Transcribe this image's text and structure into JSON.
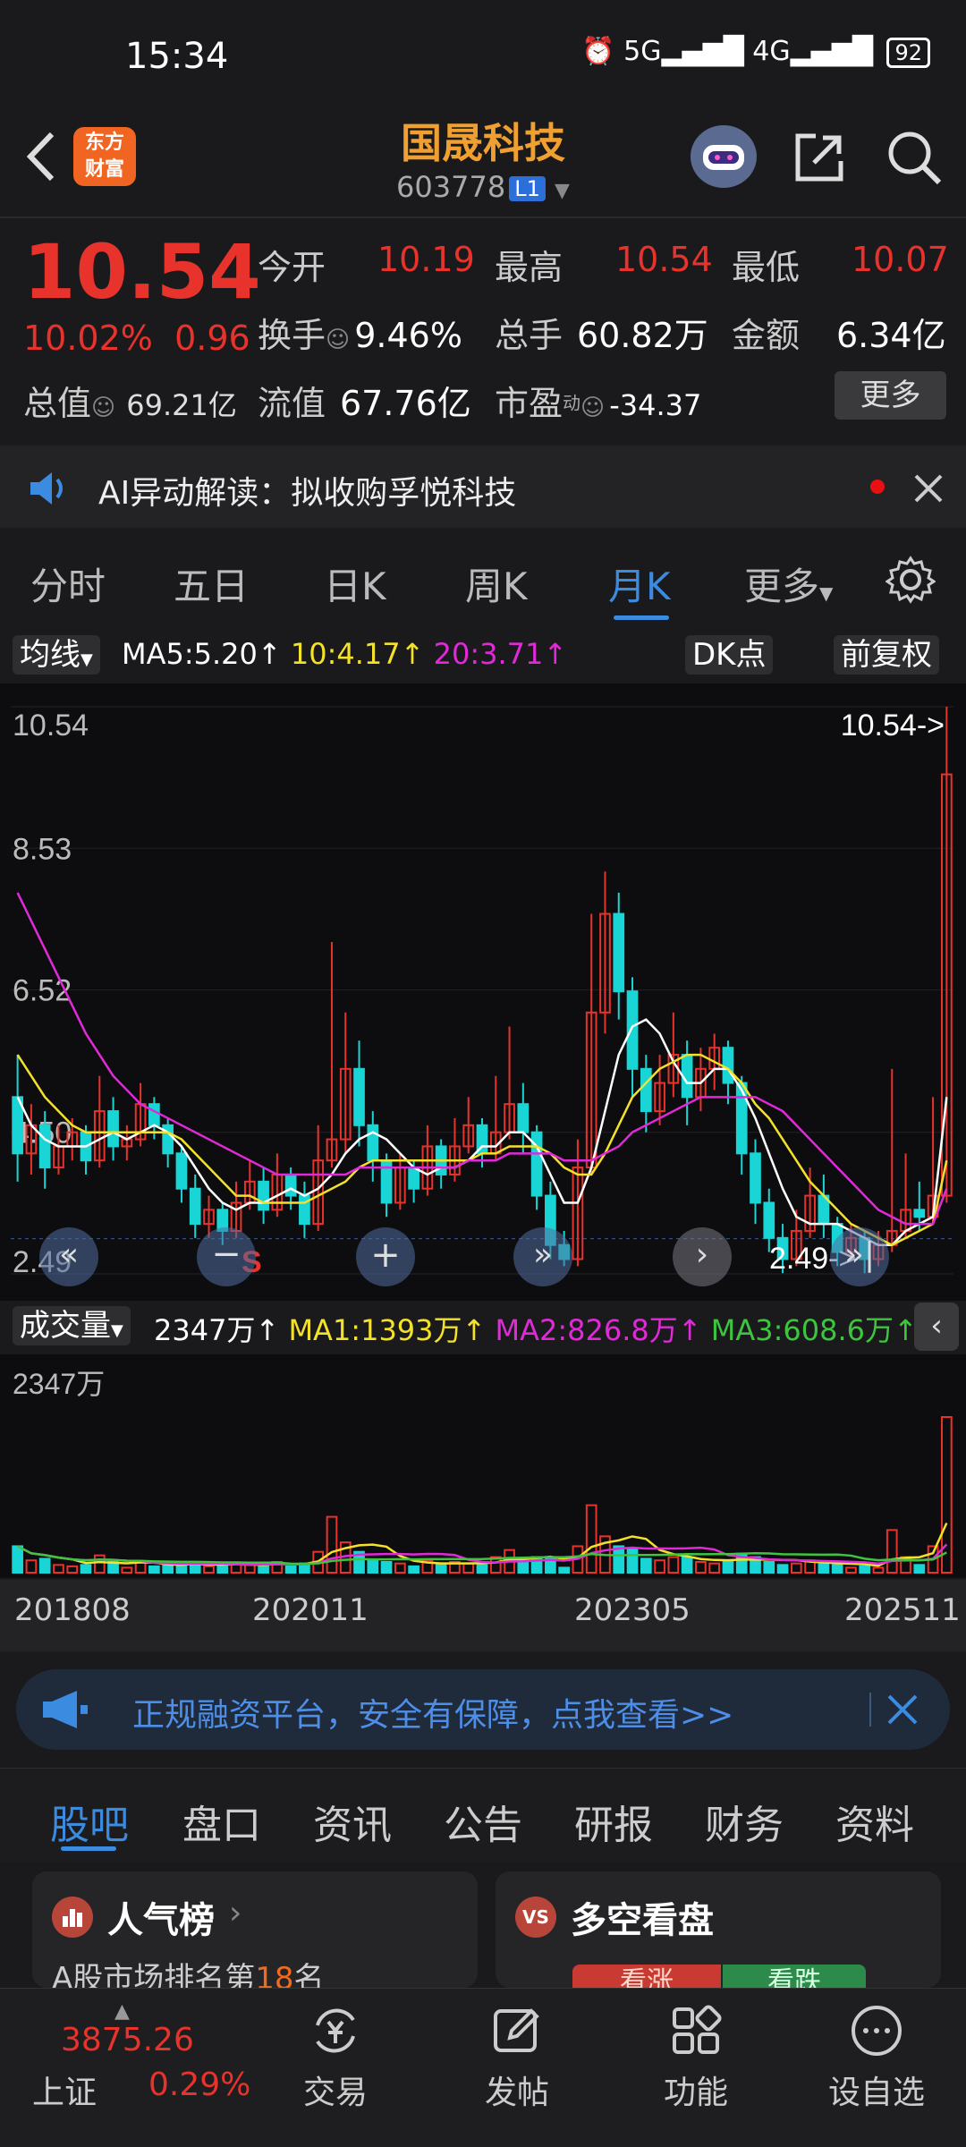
{
  "status_bar": {
    "time": "15:34",
    "icons": "⏰ 5G▂▄▆█ 4G▂▄▆█",
    "battery": "92"
  },
  "header": {
    "logo_text_1": "东方",
    "logo_text_2": "财富",
    "stock_name": "国晟科技",
    "stock_code": "603778",
    "level_badge": "L1"
  },
  "quote": {
    "price": "10.54",
    "change_pct": "10.02%",
    "change_abs": "0.96",
    "total_value_label": "总值",
    "total_value": "69.21亿",
    "open_label": "今开",
    "open": "10.19",
    "high_label": "最高",
    "high": "10.54",
    "low_label": "最低",
    "low": "10.07",
    "turnover_label": "换手",
    "turnover": "9.46%",
    "volume_label": "总手",
    "volume": "60.82万",
    "amount_label": "金额",
    "amount": "6.34亿",
    "float_label": "流值",
    "float_value": "67.76亿",
    "pe_label": "市盈",
    "pe_sup": "动",
    "pe": "-34.37",
    "more_button": "更多"
  },
  "ai_banner": {
    "text": "AI异动解读：拟收购孚悦科技"
  },
  "period_tabs": [
    "分时",
    "五日",
    "日K",
    "周K",
    "月K",
    "更多"
  ],
  "active_tab": "月K",
  "chart_toolbar": {
    "indicator": "均线",
    "ma5": "MA5:5.20↑",
    "ma10": "10:4.17↑",
    "ma20": "20:3.71↑",
    "dk": "DK点",
    "adjust": "前复权"
  },
  "chart_data": {
    "type": "candlestick",
    "y_ticks": [
      "10.54",
      "8.53",
      "6.52",
      "4.50",
      "2.49"
    ],
    "ylim": [
      2.49,
      10.54
    ],
    "max_marker": "10.54->",
    "min_marker": "2.49->",
    "signal_label": "S",
    "x_ticks": [
      "201808",
      "202011",
      "202305",
      "202511"
    ],
    "candles": [
      {
        "o": 5.0,
        "c": 4.2,
        "h": 5.6,
        "l": 3.8
      },
      {
        "o": 4.2,
        "c": 4.6,
        "h": 4.9,
        "l": 3.9
      },
      {
        "o": 4.6,
        "c": 4.0,
        "h": 4.8,
        "l": 3.7
      },
      {
        "o": 4.0,
        "c": 4.3,
        "h": 4.6,
        "l": 3.9
      },
      {
        "o": 4.3,
        "c": 4.5,
        "h": 4.7,
        "l": 4.1
      },
      {
        "o": 4.5,
        "c": 4.1,
        "h": 4.6,
        "l": 3.9
      },
      {
        "o": 4.1,
        "c": 4.8,
        "h": 5.3,
        "l": 4.0
      },
      {
        "o": 4.8,
        "c": 4.3,
        "h": 5.0,
        "l": 4.1
      },
      {
        "o": 4.3,
        "c": 4.4,
        "h": 4.6,
        "l": 4.1
      },
      {
        "o": 4.4,
        "c": 4.9,
        "h": 5.2,
        "l": 4.3
      },
      {
        "o": 4.9,
        "c": 4.6,
        "h": 5.0,
        "l": 4.4
      },
      {
        "o": 4.6,
        "c": 4.2,
        "h": 4.7,
        "l": 4.0
      },
      {
        "o": 4.2,
        "c": 3.7,
        "h": 4.3,
        "l": 3.5
      },
      {
        "o": 3.7,
        "c": 3.2,
        "h": 3.9,
        "l": 3.0
      },
      {
        "o": 3.2,
        "c": 3.4,
        "h": 3.6,
        "l": 3.0
      },
      {
        "o": 3.4,
        "c": 3.1,
        "h": 3.5,
        "l": 2.9
      },
      {
        "o": 3.1,
        "c": 3.5,
        "h": 3.8,
        "l": 3.0
      },
      {
        "o": 3.5,
        "c": 3.8,
        "h": 4.1,
        "l": 3.4
      },
      {
        "o": 3.8,
        "c": 3.4,
        "h": 4.0,
        "l": 3.2
      },
      {
        "o": 3.4,
        "c": 3.9,
        "h": 4.2,
        "l": 3.3
      },
      {
        "o": 3.9,
        "c": 3.6,
        "h": 4.0,
        "l": 3.4
      },
      {
        "o": 3.6,
        "c": 3.2,
        "h": 3.8,
        "l": 3.0
      },
      {
        "o": 3.2,
        "c": 4.1,
        "h": 4.6,
        "l": 3.1
      },
      {
        "o": 4.1,
        "c": 4.4,
        "h": 7.2,
        "l": 4.0
      },
      {
        "o": 4.4,
        "c": 5.4,
        "h": 6.2,
        "l": 4.2
      },
      {
        "o": 5.4,
        "c": 4.6,
        "h": 5.8,
        "l": 4.3
      },
      {
        "o": 4.6,
        "c": 4.1,
        "h": 4.8,
        "l": 3.8
      },
      {
        "o": 4.1,
        "c": 3.5,
        "h": 4.2,
        "l": 3.3
      },
      {
        "o": 3.5,
        "c": 4.0,
        "h": 4.2,
        "l": 3.4
      },
      {
        "o": 4.0,
        "c": 3.7,
        "h": 4.1,
        "l": 3.5
      },
      {
        "o": 3.7,
        "c": 4.3,
        "h": 4.6,
        "l": 3.6
      },
      {
        "o": 4.3,
        "c": 3.9,
        "h": 4.4,
        "l": 3.7
      },
      {
        "o": 3.9,
        "c": 4.3,
        "h": 4.7,
        "l": 3.8
      },
      {
        "o": 4.3,
        "c": 4.6,
        "h": 5.0,
        "l": 4.2
      },
      {
        "o": 4.6,
        "c": 4.2,
        "h": 4.7,
        "l": 4.0
      },
      {
        "o": 4.2,
        "c": 4.5,
        "h": 5.3,
        "l": 4.1
      },
      {
        "o": 4.5,
        "c": 4.9,
        "h": 6.0,
        "l": 4.4
      },
      {
        "o": 4.9,
        "c": 4.5,
        "h": 5.2,
        "l": 4.2
      },
      {
        "o": 4.5,
        "c": 3.6,
        "h": 4.6,
        "l": 3.4
      },
      {
        "o": 3.6,
        "c": 2.9,
        "h": 3.8,
        "l": 2.7
      },
      {
        "o": 2.9,
        "c": 2.7,
        "h": 3.1,
        "l": 2.6
      },
      {
        "o": 2.7,
        "c": 4.0,
        "h": 4.4,
        "l": 2.6
      },
      {
        "o": 4.0,
        "c": 6.2,
        "h": 7.6,
        "l": 3.9
      },
      {
        "o": 6.2,
        "c": 7.6,
        "h": 8.2,
        "l": 5.9
      },
      {
        "o": 7.6,
        "c": 6.5,
        "h": 7.9,
        "l": 6.1
      },
      {
        "o": 6.5,
        "c": 5.4,
        "h": 6.7,
        "l": 5.0
      },
      {
        "o": 5.4,
        "c": 4.8,
        "h": 5.6,
        "l": 4.5
      },
      {
        "o": 4.8,
        "c": 5.2,
        "h": 5.6,
        "l": 4.6
      },
      {
        "o": 5.2,
        "c": 5.6,
        "h": 6.2,
        "l": 5.0
      },
      {
        "o": 5.6,
        "c": 5.0,
        "h": 5.8,
        "l": 4.6
      },
      {
        "o": 5.0,
        "c": 5.4,
        "h": 5.7,
        "l": 4.8
      },
      {
        "o": 5.4,
        "c": 5.7,
        "h": 5.9,
        "l": 5.1
      },
      {
        "o": 5.7,
        "c": 5.2,
        "h": 5.8,
        "l": 4.9
      },
      {
        "o": 5.2,
        "c": 4.2,
        "h": 5.3,
        "l": 3.9
      },
      {
        "o": 4.2,
        "c": 3.5,
        "h": 4.4,
        "l": 3.2
      },
      {
        "o": 3.5,
        "c": 3.0,
        "h": 3.7,
        "l": 2.8
      },
      {
        "o": 3.0,
        "c": 2.7,
        "h": 3.2,
        "l": 2.5
      },
      {
        "o": 2.7,
        "c": 3.1,
        "h": 3.4,
        "l": 2.6
      },
      {
        "o": 3.1,
        "c": 3.6,
        "h": 4.0,
        "l": 3.0
      },
      {
        "o": 3.6,
        "c": 3.2,
        "h": 3.9,
        "l": 3.0
      },
      {
        "o": 3.2,
        "c": 2.8,
        "h": 3.3,
        "l": 2.6
      },
      {
        "o": 2.8,
        "c": 3.0,
        "h": 3.2,
        "l": 2.7
      },
      {
        "o": 3.0,
        "c": 2.7,
        "h": 3.1,
        "l": 2.5
      },
      {
        "o": 2.7,
        "c": 2.9,
        "h": 3.1,
        "l": 2.6
      },
      {
        "o": 2.9,
        "c": 3.1,
        "h": 5.4,
        "l": 2.8
      },
      {
        "o": 3.1,
        "c": 3.4,
        "h": 4.2,
        "l": 3.0
      },
      {
        "o": 3.4,
        "c": 3.3,
        "h": 3.8,
        "l": 3.1
      },
      {
        "o": 3.3,
        "c": 3.6,
        "h": 5.0,
        "l": 3.2
      },
      {
        "o": 3.6,
        "c": 9.58,
        "h": 10.54,
        "l": 3.5
      }
    ],
    "ma5": [
      5.0,
      4.6,
      4.4,
      4.3,
      4.3,
      4.3,
      4.4,
      4.5,
      4.4,
      4.5,
      4.6,
      4.5,
      4.3,
      4.0,
      3.7,
      3.5,
      3.4,
      3.5,
      3.5,
      3.6,
      3.7,
      3.6,
      3.7,
      3.9,
      4.2,
      4.4,
      4.5,
      4.4,
      4.2,
      4.0,
      3.9,
      4.0,
      4.0,
      4.1,
      4.3,
      4.3,
      4.5,
      4.5,
      4.3,
      3.9,
      3.5,
      3.5,
      4.0,
      4.8,
      5.6,
      6.0,
      6.1,
      5.9,
      5.5,
      5.2,
      5.2,
      5.4,
      5.4,
      5.1,
      4.7,
      4.2,
      3.7,
      3.3,
      3.2,
      3.2,
      3.2,
      3.1,
      3.0,
      2.9,
      2.9,
      3.1,
      3.2,
      3.3,
      5.0
    ],
    "ma10": [
      5.6,
      5.3,
      5.0,
      4.8,
      4.6,
      4.5,
      4.5,
      4.5,
      4.5,
      4.5,
      4.5,
      4.5,
      4.4,
      4.2,
      4.0,
      3.8,
      3.6,
      3.6,
      3.5,
      3.5,
      3.5,
      3.5,
      3.6,
      3.7,
      3.8,
      4.0,
      4.1,
      4.1,
      4.1,
      4.1,
      4.1,
      4.1,
      4.1,
      4.1,
      4.2,
      4.2,
      4.3,
      4.3,
      4.3,
      4.2,
      4.0,
      3.9,
      3.9,
      4.2,
      4.6,
      5.0,
      5.2,
      5.4,
      5.5,
      5.6,
      5.6,
      5.5,
      5.4,
      5.2,
      4.9,
      4.7,
      4.4,
      4.1,
      3.8,
      3.6,
      3.4,
      3.2,
      3.1,
      3.0,
      2.9,
      3.0,
      3.1,
      3.2,
      4.1
    ],
    "ma20": [
      7.9,
      7.5,
      7.1,
      6.7,
      6.3,
      5.9,
      5.6,
      5.3,
      5.1,
      4.9,
      4.8,
      4.7,
      4.6,
      4.5,
      4.4,
      4.3,
      4.2,
      4.1,
      4.0,
      3.9,
      3.9,
      3.9,
      3.9,
      3.9,
      3.9,
      4.0,
      4.0,
      4.0,
      4.0,
      4.0,
      4.0,
      4.0,
      4.0,
      4.1,
      4.1,
      4.1,
      4.2,
      4.2,
      4.2,
      4.2,
      4.1,
      4.1,
      4.1,
      4.2,
      4.3,
      4.5,
      4.6,
      4.7,
      4.8,
      4.9,
      5.0,
      5.0,
      5.0,
      5.0,
      5.0,
      4.9,
      4.8,
      4.6,
      4.4,
      4.2,
      4.0,
      3.8,
      3.6,
      3.4,
      3.3,
      3.2,
      3.2,
      3.2,
      3.7
    ]
  },
  "volume_toolbar": {
    "label": "成交量",
    "current": "2347万↑",
    "ma1": "MA1:1393万↑",
    "ma2": "MA2:826.8万↑",
    "ma3": "MA3:608.6万↑",
    "max_label": "2347万"
  },
  "ad_banner": {
    "text": "正规融资平台，安全有保障，点我查看>>"
  },
  "bottom_tabs": [
    "股吧",
    "盘口",
    "资讯",
    "公告",
    "研报",
    "财务",
    "资料"
  ],
  "active_bottom_tab": "股吧",
  "cards": {
    "popularity_title": "人气榜",
    "popularity_sub_prefix": "A股市场排名第",
    "popularity_rank": "18",
    "popularity_sub_suffix": "名",
    "bullbear_title": "多空看盘",
    "bull": "看涨",
    "bear": "看跌"
  },
  "bottom_nav": {
    "index_value": "3875.26",
    "index_name": "上证",
    "index_pct": "0.29%",
    "trade": "交易",
    "post": "发帖",
    "function": "功能",
    "watchlist": "设自选"
  }
}
